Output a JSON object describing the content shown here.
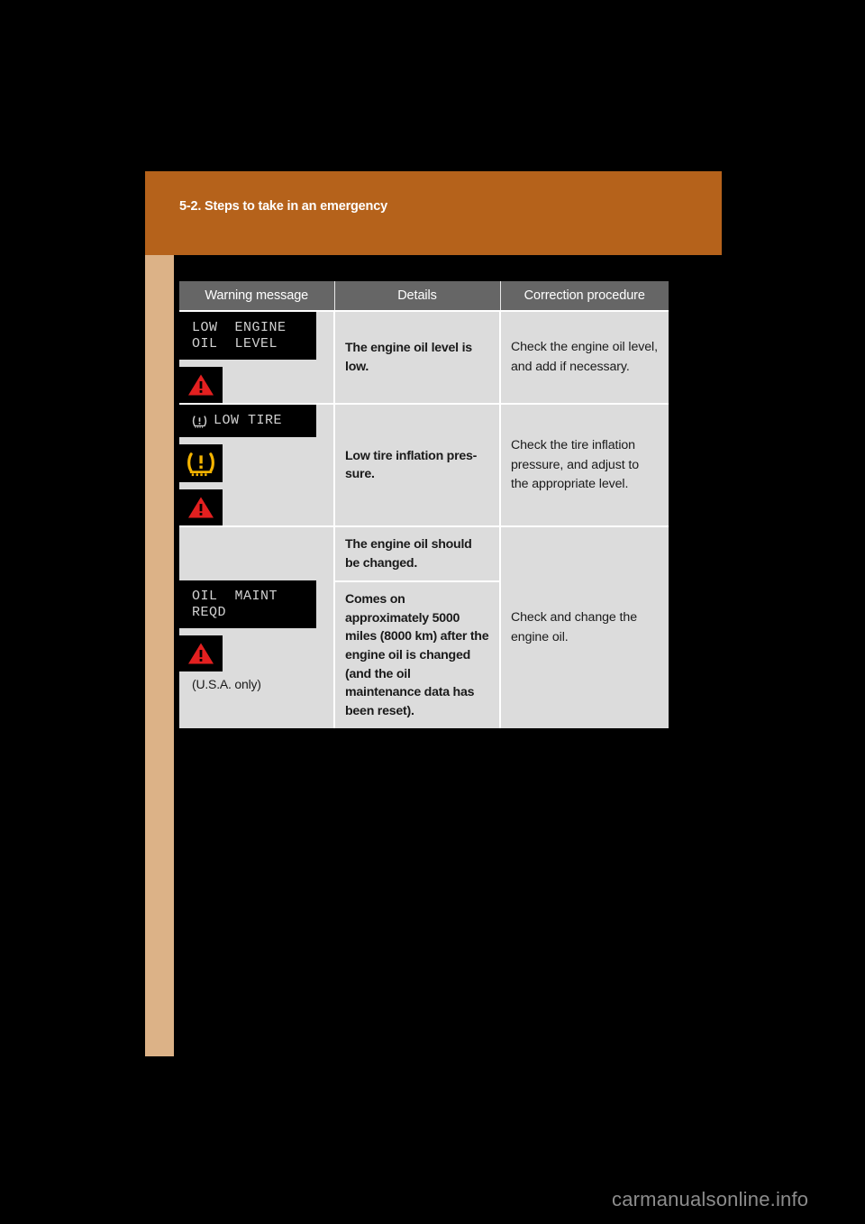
{
  "page": {
    "chapter_title": "5-2. Steps to take in an emergency",
    "watermark": "carmanualsonline.info",
    "colors": {
      "page_background": "#000000",
      "chapter_band": "#b5621b",
      "edge_tab": "#dcb287",
      "table_header": "#666666",
      "table_cell": "#dcdcdc",
      "lcd_background": "#000000",
      "lcd_text": "#d2d2d2",
      "warning_red": "#e32020",
      "tpms_amber": "#f5b400"
    }
  },
  "table": {
    "headers": {
      "warning_message": "Warning message",
      "details": "Details",
      "correction_procedure": "Correction procedure"
    },
    "rows": [
      {
        "lcd_lines": [
          "LOW  ENGINE",
          "OIL  LEVEL"
        ],
        "lcd_prefix_icon": "",
        "icons": [
          "warning-triangle-icon"
        ],
        "note": "",
        "details": [
          "The engine oil level is low."
        ],
        "correction": "Check the engine oil level, and add if necessary."
      },
      {
        "lcd_lines": [
          "LOW TIRE"
        ],
        "lcd_prefix_icon": "tpms-icon",
        "icons": [
          "tpms-icon",
          "warning-triangle-icon"
        ],
        "note": "",
        "details": [
          "Low tire inflation pres-sure."
        ],
        "correction": "Check the tire inflation pressure, and adjust to the appropriate level."
      },
      {
        "lcd_lines": [
          "OIL  MAINT",
          "REQD"
        ],
        "lcd_prefix_icon": "",
        "icons": [
          "warning-triangle-icon"
        ],
        "note": "(U.S.A. only)",
        "details": [
          "The engine oil should be changed.",
          "Comes on approximately 5000 miles (8000 km) after the engine oil is changed (and the oil maintenance data has been reset)."
        ],
        "correction": "Check and change the engine oil."
      }
    ]
  }
}
